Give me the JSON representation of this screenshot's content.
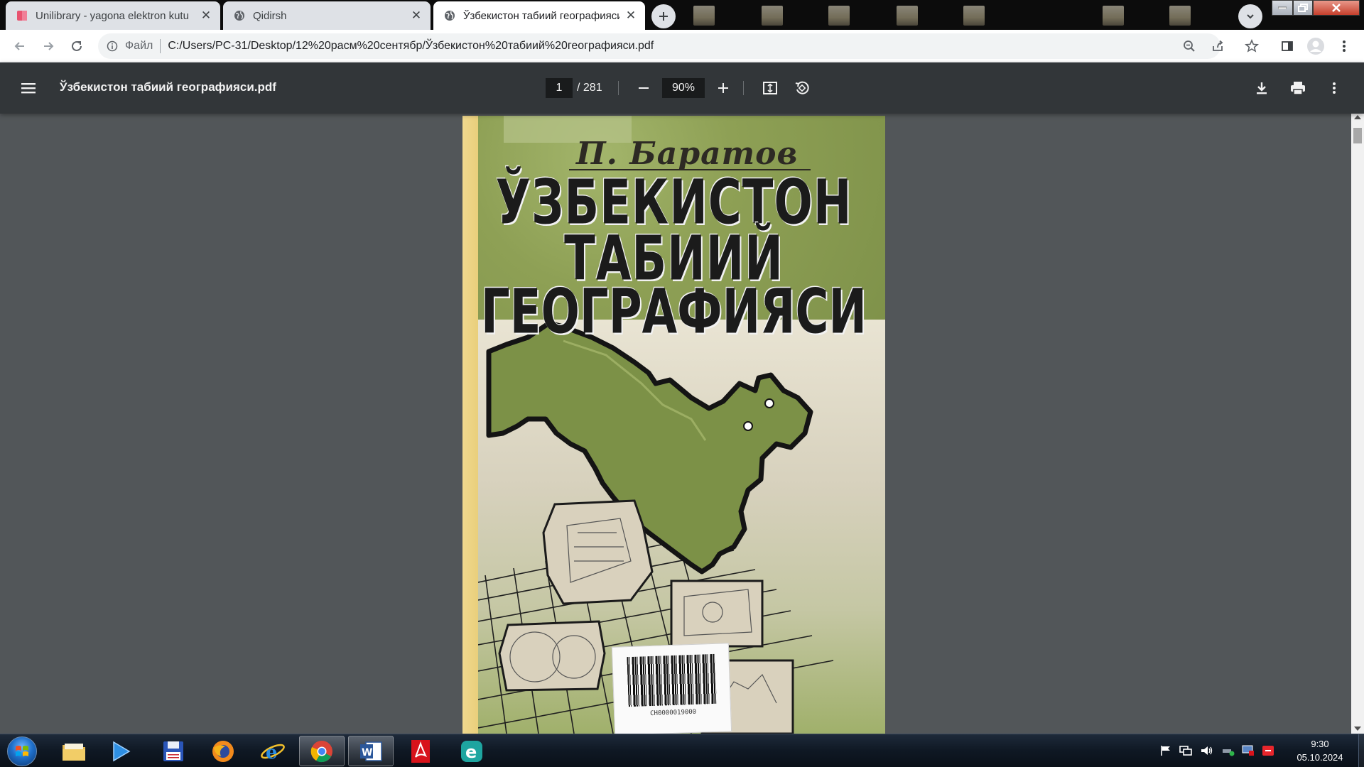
{
  "browser": {
    "tabs": [
      {
        "title": "Unilibrary - yagona elektron kutu",
        "icon": "unilibrary-favicon",
        "active": false
      },
      {
        "title": "Qidirsh",
        "icon": "globe-icon",
        "active": false
      },
      {
        "title": "Ўзбекистон табиий географияси",
        "icon": "globe-icon",
        "active": true
      }
    ],
    "toolbar": {
      "scheme_label": "Файл",
      "url": "C:/Users/PC-31/Desktop/12%20расм%20сентябр/Ўзбекистон%20табиий%20географияси.pdf"
    }
  },
  "pdf_viewer": {
    "file_title": "Ўзбекистон табиий географияси.pdf",
    "current_page": "1",
    "total_pages": "/ 281",
    "zoom": "90%"
  },
  "cover": {
    "author": "П. Баратов",
    "title_lines": [
      "ЎЗБЕКИСТОН",
      "ТАБИИЙ",
      "ГЕОГРАФИЯСИ"
    ],
    "barcode_text": "CH0000019000"
  },
  "taskbar": {
    "apps": [
      "windows-explorer",
      "media-player",
      "save-disk",
      "firefox",
      "internet-explorer",
      "chrome",
      "word",
      "acrobat",
      "edge"
    ],
    "time": "9:30",
    "date": "05.10.2024"
  },
  "colors": {
    "tab_strip": "#0c0c0c",
    "pdf_toolbar": "#323639",
    "viewer_bg": "#525659",
    "cover_green": "#8fa257"
  }
}
